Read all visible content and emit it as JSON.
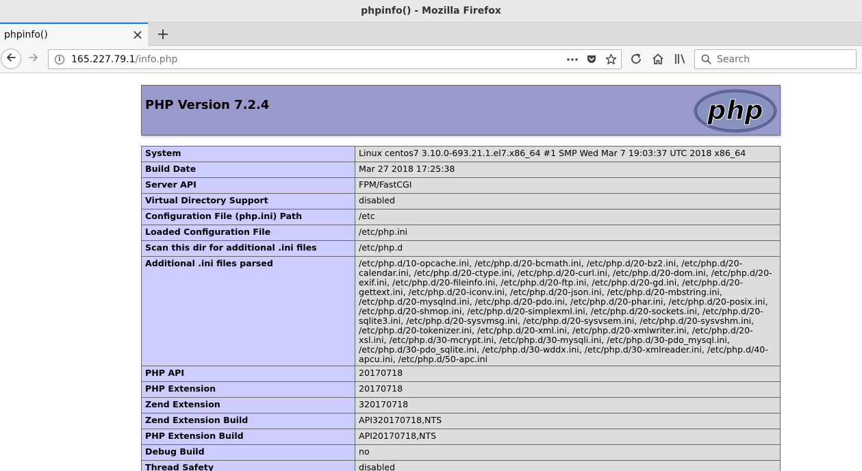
{
  "window": {
    "title": "phpinfo() - Mozilla Firefox"
  },
  "tab": {
    "title": "phpinfo()"
  },
  "navbar": {
    "url_host": "165.227.79.1",
    "url_path": "/info.php",
    "search_placeholder": "Search"
  },
  "page": {
    "heading": "PHP Version 7.2.4",
    "logo_text": "php",
    "rows": [
      {
        "key": "System",
        "value": "Linux centos7 3.10.0-693.21.1.el7.x86_64 #1 SMP Wed Mar 7 19:03:37 UTC 2018 x86_64"
      },
      {
        "key": "Build Date",
        "value": "Mar 27 2018 17:25:38"
      },
      {
        "key": "Server API",
        "value": "FPM/FastCGI"
      },
      {
        "key": "Virtual Directory Support",
        "value": "disabled"
      },
      {
        "key": "Configuration File (php.ini) Path",
        "value": "/etc"
      },
      {
        "key": "Loaded Configuration File",
        "value": "/etc/php.ini"
      },
      {
        "key": "Scan this dir for additional .ini files",
        "value": "/etc/php.d"
      },
      {
        "key": "Additional .ini files parsed",
        "value": "/etc/php.d/10-opcache.ini, /etc/php.d/20-bcmath.ini, /etc/php.d/20-bz2.ini, /etc/php.d/20-calendar.ini, /etc/php.d/20-ctype.ini, /etc/php.d/20-curl.ini, /etc/php.d/20-dom.ini, /etc/php.d/20-exif.ini, /etc/php.d/20-fileinfo.ini, /etc/php.d/20-ftp.ini, /etc/php.d/20-gd.ini, /etc/php.d/20-gettext.ini, /etc/php.d/20-iconv.ini, /etc/php.d/20-json.ini, /etc/php.d/20-mbstring.ini, /etc/php.d/20-mysqlnd.ini, /etc/php.d/20-pdo.ini, /etc/php.d/20-phar.ini, /etc/php.d/20-posix.ini, /etc/php.d/20-shmop.ini, /etc/php.d/20-simplexml.ini, /etc/php.d/20-sockets.ini, /etc/php.d/20-sqlite3.ini, /etc/php.d/20-sysvmsg.ini, /etc/php.d/20-sysvsem.ini, /etc/php.d/20-sysvshm.ini, /etc/php.d/20-tokenizer.ini, /etc/php.d/20-xml.ini, /etc/php.d/20-xmlwriter.ini, /etc/php.d/20-xsl.ini, /etc/php.d/30-mcrypt.ini, /etc/php.d/30-mysqli.ini, /etc/php.d/30-pdo_mysql.ini, /etc/php.d/30-pdo_sqlite.ini, /etc/php.d/30-wddx.ini, /etc/php.d/30-xmlreader.ini, /etc/php.d/40-apcu.ini, /etc/php.d/50-apc.ini"
      },
      {
        "key": "PHP API",
        "value": "20170718"
      },
      {
        "key": "PHP Extension",
        "value": "20170718"
      },
      {
        "key": "Zend Extension",
        "value": "320170718"
      },
      {
        "key": "Zend Extension Build",
        "value": "API320170718,NTS"
      },
      {
        "key": "PHP Extension Build",
        "value": "API20170718,NTS"
      },
      {
        "key": "Debug Build",
        "value": "no"
      },
      {
        "key": "Thread Safety",
        "value": "disabled"
      },
      {
        "key": "",
        "value": ""
      }
    ]
  },
  "colors": {
    "header_bg": "#9999cc",
    "key_cell_bg": "#ccccff",
    "value_cell_bg": "#dddddd",
    "tab_accent": "#0a84ff"
  },
  "icons": {
    "tab_close": "close-icon",
    "new_tab": "plus-icon",
    "back": "arrow-left-icon",
    "forward": "arrow-right-icon",
    "site_info": "info-icon",
    "page_actions": "more-icon",
    "pocket": "pocket-icon",
    "bookmark": "star-icon",
    "reload": "reload-icon",
    "home": "home-icon",
    "library": "library-icon",
    "search": "search-icon"
  }
}
